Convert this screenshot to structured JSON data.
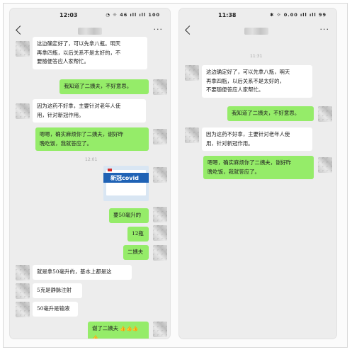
{
  "left_phone": {
    "status": {
      "time": "12:03",
      "icons": "◔ ☼ 46 ıll ıll 100"
    },
    "nav": {
      "more": "···"
    },
    "messages": [
      {
        "id": "l1",
        "side": "recv",
        "lines": [
          "这边确定好了，可以先拿八瓶。明天",
          "再拿四瓶，以后关系不是太好的，不",
          "要随便答应人家帮忙。"
        ]
      },
      {
        "id": "l2",
        "side": "sent",
        "lines": [
          "我知道了二姨夫，不好意思。"
        ]
      },
      {
        "id": "l3",
        "side": "recv",
        "lines": [
          "因为这药不好拿，主要针对老年人使",
          "用，针对新冠作用。"
        ]
      },
      {
        "id": "l4",
        "side": "sent",
        "lines": [
          "嗯嗯，确实麻烦你了二姨夫，谢好昨",
          "晚吃饭，我就答应了。"
        ]
      },
      {
        "id": "l5",
        "side": "time",
        "text": "12:01"
      },
      {
        "id": "l6",
        "side": "image",
        "brand": "新冠covid",
        "sub": "Molnupiravir"
      },
      {
        "id": "l7",
        "side": "sent",
        "lines": [
          "要50毫升的"
        ]
      },
      {
        "id": "l8",
        "side": "sent",
        "lines": [
          "12瓶"
        ]
      },
      {
        "id": "l9",
        "side": "sent",
        "lines": [
          "二姨夫"
        ]
      },
      {
        "id": "l10",
        "side": "recv",
        "lines": [
          "就是拿50毫升的，基本上都是这"
        ]
      },
      {
        "id": "l11",
        "side": "recv",
        "lines": [
          "5克是静脉注射"
        ]
      },
      {
        "id": "l12",
        "side": "recv",
        "lines": [
          "50毫升是输液"
        ]
      },
      {
        "id": "l13",
        "side": "sent",
        "lines": [
          "谢了二姨夫"
        ],
        "emoji": "👍👍👍👍"
      }
    ]
  },
  "right_phone": {
    "status": {
      "time": "11:38",
      "icons": "✱ ☼ 0.00 ıll ıll 99"
    },
    "nav": {
      "more": "···"
    },
    "messages": [
      {
        "id": "r0",
        "side": "time",
        "text": "11:31"
      },
      {
        "id": "r1",
        "side": "recv",
        "lines": [
          "这边确定好了，可以先拿八瓶，明天",
          "再拿四瓶，以后关系不是太好的，",
          "不要随便答应人家帮忙。"
        ]
      },
      {
        "id": "r2",
        "side": "sent",
        "lines": [
          "我知道了二姨夫，不好意思。"
        ]
      },
      {
        "id": "r3",
        "side": "recv",
        "lines": [
          "因为这药不好拿，主要针对老年人使",
          "用，针对新冠作用。"
        ]
      },
      {
        "id": "r4",
        "side": "sent",
        "lines": [
          "嗯嗯，确实麻烦你了二姨夫，谢好昨",
          "晚吃饭，我就答应了。"
        ]
      }
    ]
  }
}
